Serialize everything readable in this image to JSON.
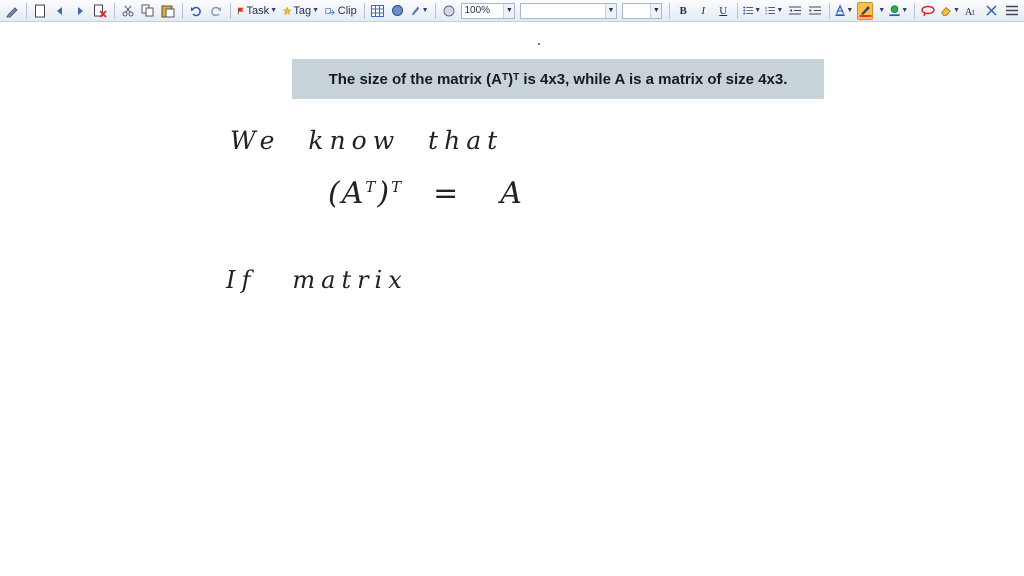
{
  "toolbar": {
    "task_label": "Task",
    "tag_label": "Tag",
    "clip_label": "Clip",
    "zoom_value": "100%",
    "font_name_value": "",
    "font_size_value": "",
    "bold_label": "B",
    "italic_label": "I",
    "underline_label": "U"
  },
  "page": {
    "question": {
      "prefix": "The size of the matrix (A",
      "sup1": "T",
      "mid": ")",
      "sup2": "T",
      "suffix": " is 4x3, while A is a matrix of size 4x3."
    },
    "handwriting": {
      "line1": "We know that",
      "equation_left": "(A",
      "equation_sup1": "T",
      "equation_close": ")",
      "equation_sup2": "T",
      "equation_eq": "=",
      "equation_right": "A",
      "line3_word1": "If",
      "line3_word2": "matrix"
    }
  },
  "colors": {
    "question_bg": "#c7d3d9",
    "ink": "#222222",
    "toolbar_bg": "#e4ebf5",
    "highlight": "#f7c24a"
  }
}
